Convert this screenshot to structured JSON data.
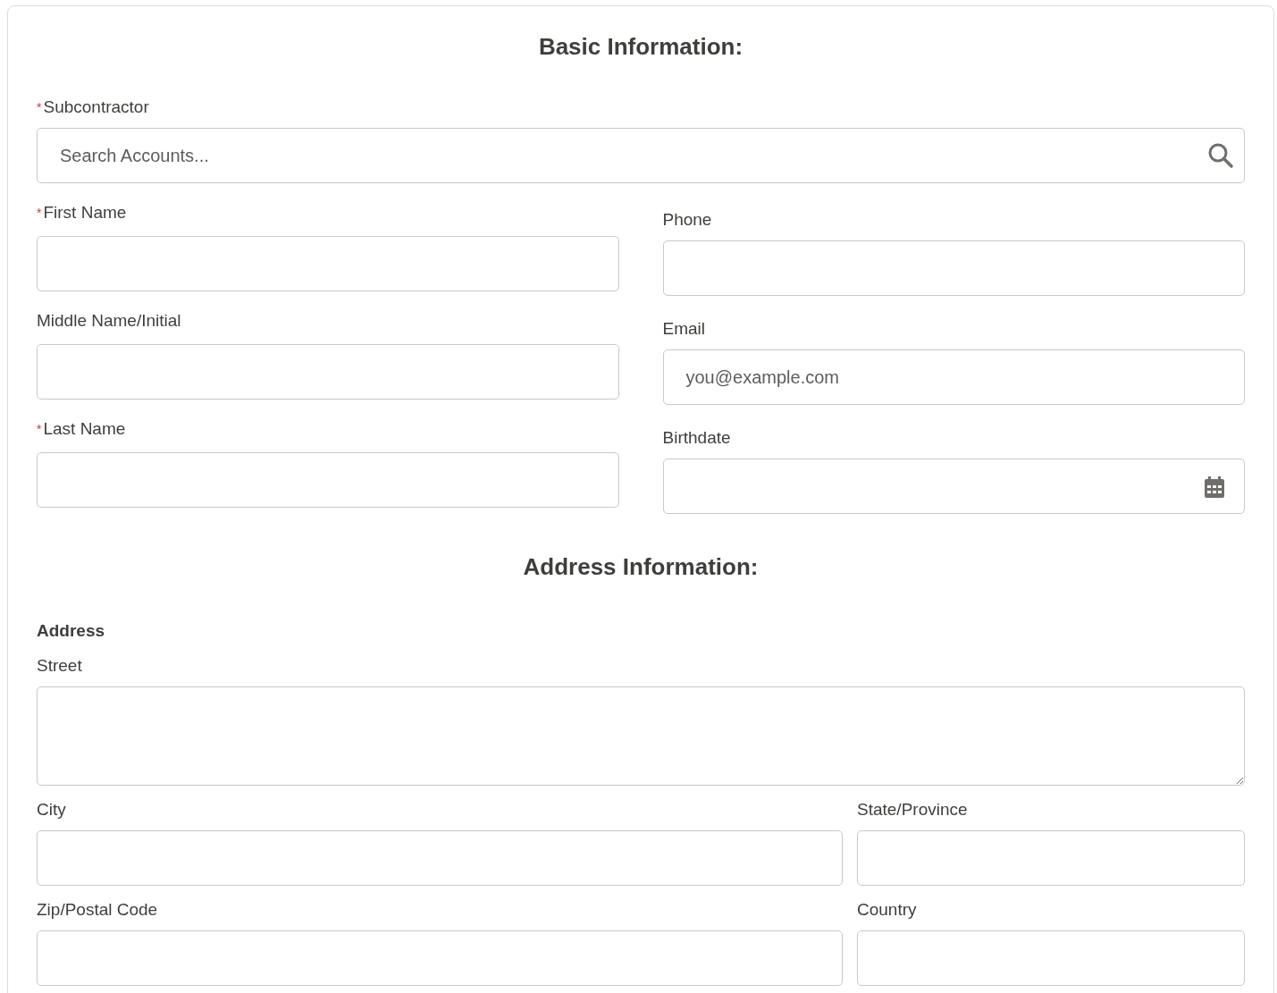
{
  "basic_information": {
    "heading": "Basic Information:",
    "subcontractor": {
      "label": "Subcontractor",
      "required_mark": "*",
      "placeholder": "Search Accounts..."
    },
    "left_fields": [
      {
        "label": "First Name",
        "required_mark": "*",
        "kind": "text"
      },
      {
        "label": "Middle Name/Initial",
        "kind": "text"
      },
      {
        "label": "Last Name",
        "required_mark": "*",
        "kind": "text"
      }
    ],
    "right_fields": [
      {
        "label": "Phone",
        "kind": "text"
      },
      {
        "label": "Email",
        "kind": "text",
        "placeholder": "you@example.com"
      },
      {
        "label": "Birthdate",
        "kind": "date"
      }
    ]
  },
  "address_information": {
    "heading": "Address Information:",
    "group_label": "Address",
    "street": {
      "label": "Street"
    },
    "rows": [
      [
        {
          "label": "City"
        },
        {
          "label": "State/Province"
        }
      ],
      [
        {
          "label": "Zip/Postal Code"
        },
        {
          "label": "Country"
        }
      ]
    ]
  }
}
